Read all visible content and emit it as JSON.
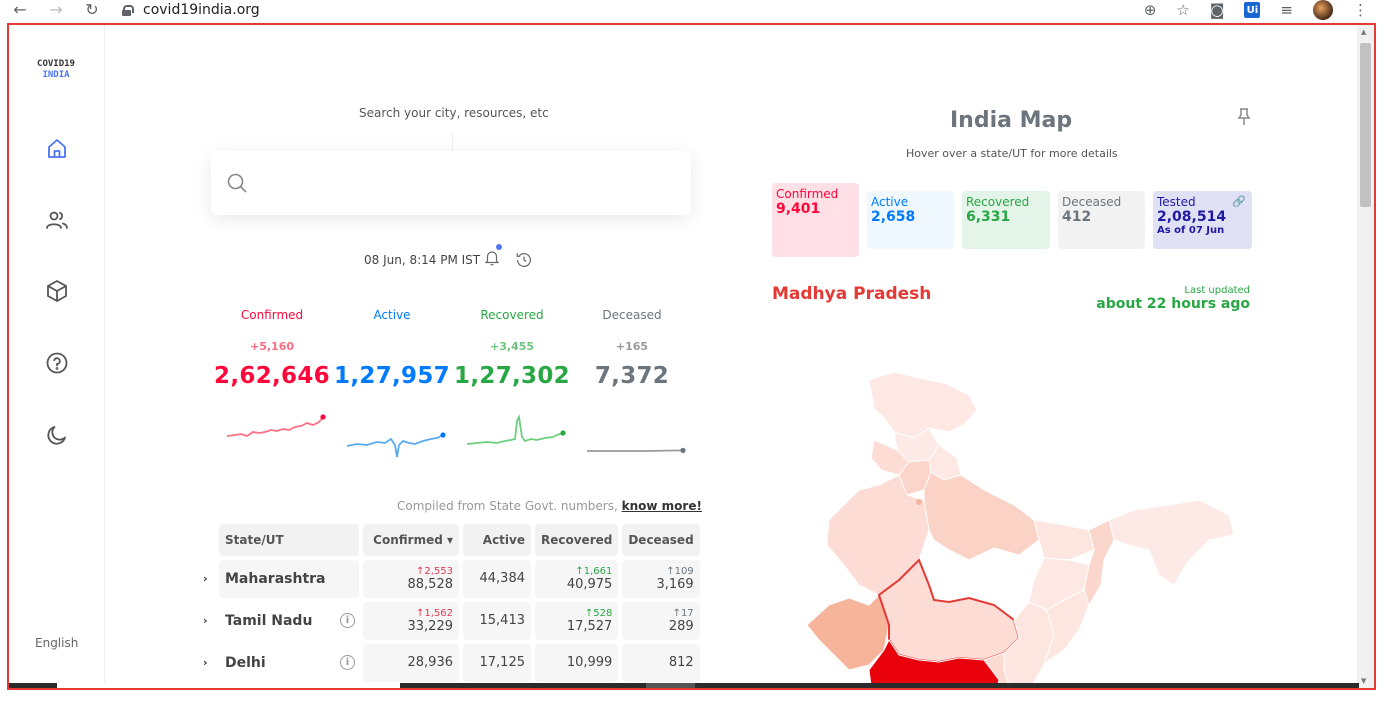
{
  "browser": {
    "url": "covid19india.org"
  },
  "sidebar": {
    "logo_line1": "COVID19",
    "logo_line2": "INDIA",
    "language": "English"
  },
  "search": {
    "label": "Search your city, resources, etc",
    "placeholder": ""
  },
  "timestamp": "08 Jun, 8:14 PM IST",
  "stats": [
    {
      "label": "Confirmed",
      "delta": "+5,160",
      "value": "2,62,646",
      "color": "#ff073a"
    },
    {
      "label": "Active",
      "delta": "",
      "value": "1,27,957",
      "color": "#007bff"
    },
    {
      "label": "Recovered",
      "delta": "+3,455",
      "value": "1,27,302",
      "color": "#28a745"
    },
    {
      "label": "Deceased",
      "delta": "+165",
      "value": "7,372",
      "color": "#6c757d"
    }
  ],
  "compiled": {
    "text": "Compiled from State Govt. numbers,",
    "link": "know more!"
  },
  "table": {
    "headers": [
      "State/UT",
      "Confirmed ▾",
      "Active",
      "Recovered",
      "Deceased"
    ],
    "rows": [
      {
        "name": "Maharashtra",
        "confirmed_inc": "↑2,553",
        "confirmed": "88,528",
        "active": "44,384",
        "recovered_inc": "↑1,661",
        "recovered": "40,975",
        "deceased_inc": "↑109",
        "deceased": "3,169"
      },
      {
        "name": "Tamil Nadu",
        "confirmed_inc": "↑1,562",
        "confirmed": "33,229",
        "active": "15,413",
        "recovered_inc": "↑528",
        "recovered": "17,527",
        "deceased_inc": "↑17",
        "deceased": "289"
      },
      {
        "name": "Delhi",
        "confirmed_inc": "",
        "confirmed": "28,936",
        "active": "17,125",
        "recovered_inc": "",
        "recovered": "10,999",
        "deceased_inc": "",
        "deceased": "812"
      }
    ]
  },
  "map": {
    "title": "India Map",
    "hint": "Hover over a state/UT for more details",
    "cards": [
      {
        "label": "Confirmed",
        "value": "9,401",
        "sub": ""
      },
      {
        "label": "Active",
        "value": "2,658",
        "sub": ""
      },
      {
        "label": "Recovered",
        "value": "6,331",
        "sub": ""
      },
      {
        "label": "Deceased",
        "value": "412",
        "sub": ""
      },
      {
        "label": "Tested",
        "value": "2,08,514",
        "sub": "As of 07 Jun"
      }
    ],
    "state": "Madhya Pradesh",
    "updated_label": "Last updated",
    "updated_value": "about 22 hours ago"
  }
}
